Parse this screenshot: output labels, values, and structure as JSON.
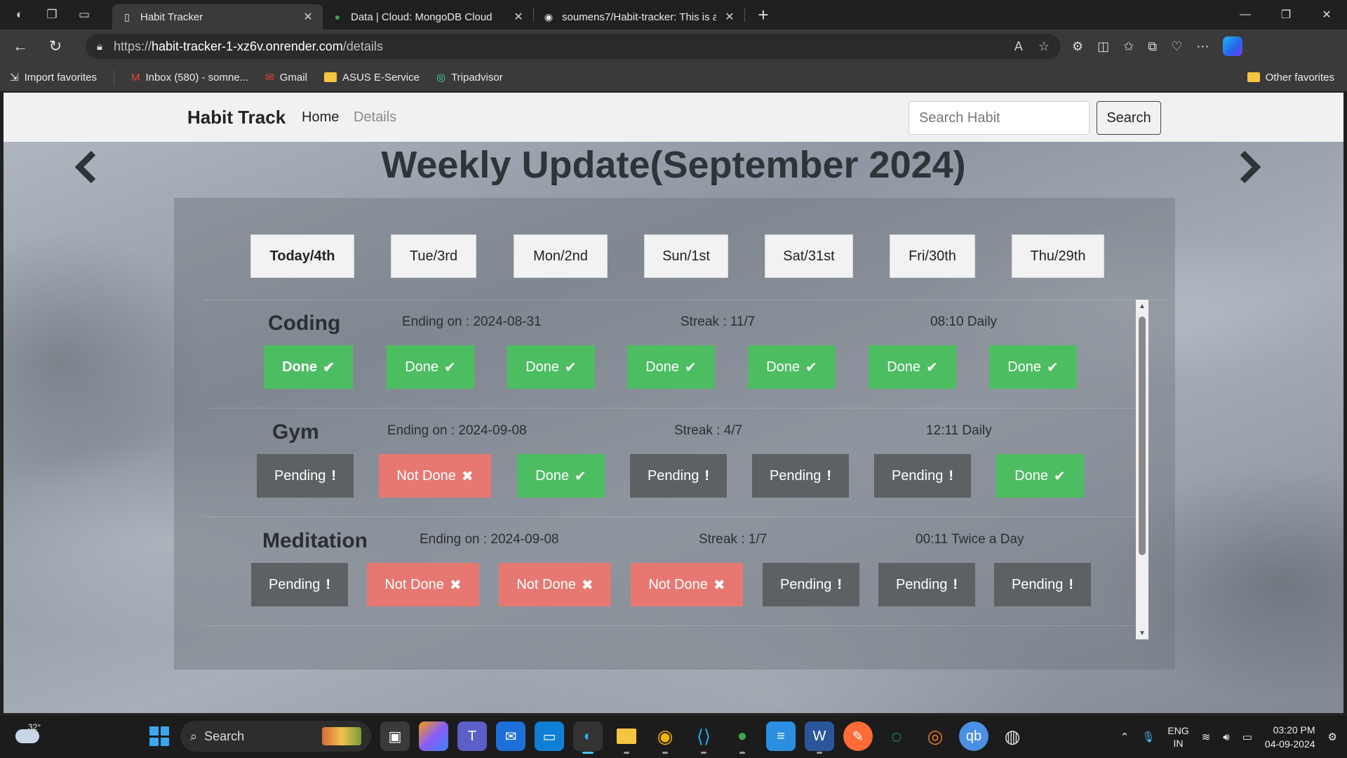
{
  "browser": {
    "tabs": [
      {
        "title": "Habit Tracker",
        "active": true
      },
      {
        "title": "Data | Cloud: MongoDB Cloud",
        "active": false
      },
      {
        "title": "soumens7/Habit-tracker: This is a",
        "active": false
      }
    ],
    "url": {
      "prefix": "https://",
      "host": "habit-tracker-1-xz6v.onrender.com",
      "path": "/details"
    },
    "favorites": [
      {
        "label": "Import favorites",
        "icon": "import-icon"
      },
      {
        "label": "Inbox (580) - somne...",
        "icon": "gmail-icon"
      },
      {
        "label": "Gmail",
        "icon": "gmail-icon"
      },
      {
        "label": "ASUS E-Service",
        "icon": "folder-icon"
      },
      {
        "label": "Tripadvisor",
        "icon": "tripadvisor-icon"
      }
    ],
    "other_favorites": "Other favorites"
  },
  "app": {
    "brand": "Habit Track",
    "nav": {
      "home": "Home",
      "details": "Details"
    },
    "search": {
      "placeholder": "Search Habit",
      "button": "Search"
    },
    "title": "Weekly Update(September 2024)",
    "days": [
      "Today/4th",
      "Tue/3rd",
      "Mon/2nd",
      "Sun/1st",
      "Sat/31st",
      "Fri/30th",
      "Thu/29th"
    ],
    "status_labels": {
      "done": "Done",
      "not_done": "Not Done",
      "pending": "Pending"
    },
    "status_icons": {
      "done": "✔",
      "not_done": "✖",
      "pending": "!"
    },
    "colors": {
      "done": "#4dbd62",
      "not_done": "#e77871",
      "pending": "#5d6163"
    },
    "habits": [
      {
        "name": "Coding",
        "ending": "Ending on : 2024-08-31",
        "streak": "Streak : 11/7",
        "schedule": "08:10 Daily",
        "statuses": [
          "done",
          "done",
          "done",
          "done",
          "done",
          "done",
          "done"
        ]
      },
      {
        "name": "Gym",
        "ending": "Ending on : 2024-09-08",
        "streak": "Streak : 4/7",
        "schedule": "12:11 Daily",
        "statuses": [
          "pending",
          "not_done",
          "done",
          "pending",
          "pending",
          "pending",
          "done"
        ]
      },
      {
        "name": "Meditation",
        "ending": "Ending on : 2024-09-08",
        "streak": "Streak : 1/7",
        "schedule": "00:11 Twice a Day",
        "statuses": [
          "pending",
          "not_done",
          "not_done",
          "not_done",
          "pending",
          "pending",
          "pending"
        ]
      }
    ]
  },
  "taskbar": {
    "temperature": "32°",
    "search": "Search",
    "lang": {
      "line1": "ENG",
      "line2": "IN"
    },
    "time": "03:20 PM",
    "date": "04-09-2024"
  }
}
